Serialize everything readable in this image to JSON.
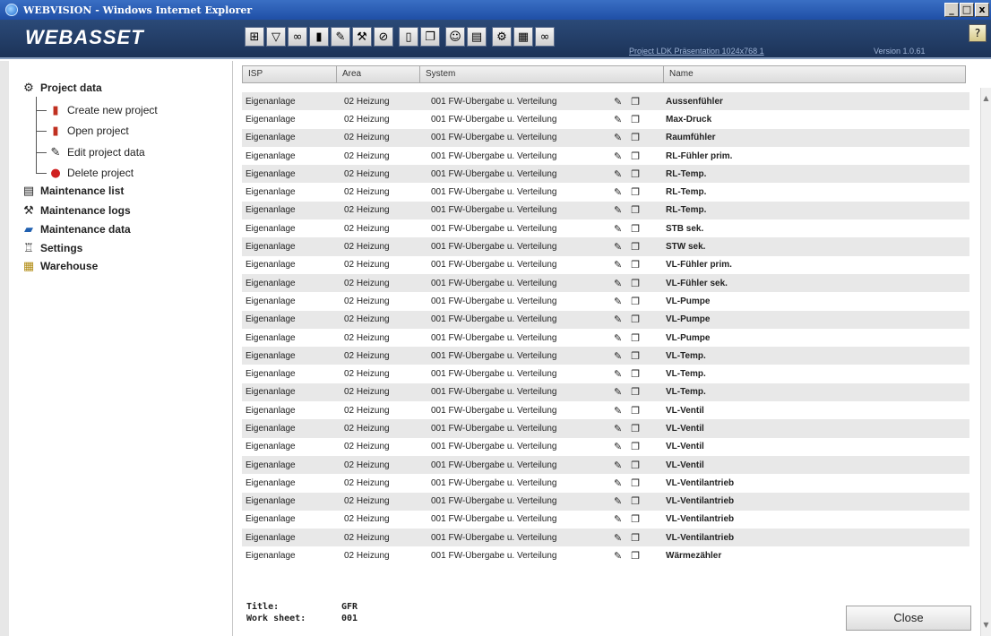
{
  "window": {
    "title": "WEBVISION - Windows Internet Explorer",
    "controls": [
      "_",
      "□",
      "x"
    ]
  },
  "app": {
    "brand": "WEBASSET",
    "project_link": "Project LDK Präsentation 1024x768 1",
    "version": "Version 1.0.61",
    "toolbar_icons": [
      "tree-icon",
      "filter-icon",
      "binoculars-icon",
      "book-icon",
      "edit-icon",
      "wrench-icon",
      "stop-icon",
      "new-document-icon",
      "copy-document-icon",
      "people-icon",
      "chart-icon",
      "maintenance-icon",
      "database-icon",
      "glasses-icon"
    ]
  },
  "sidebar": {
    "project_data": "Project data",
    "create_new_project": "Create new project",
    "open_project": "Open project",
    "edit_project_data": "Edit project data",
    "delete_project": "Delete project",
    "maintenance_list": "Maintenance list",
    "maintenance_logs": "Maintenance logs",
    "maintenance_data": "Maintenance data",
    "settings": "Settings",
    "warehouse": "Warehouse"
  },
  "table": {
    "headers": {
      "isp": "ISP",
      "area": "Area",
      "system": "System",
      "name": "Name"
    },
    "rows": [
      {
        "isp": "Eigenanlage",
        "area": "02 Heizung",
        "system": "001 FW-Übergabe u. Verteilung",
        "name": "Aussenfühler"
      },
      {
        "isp": "Eigenanlage",
        "area": "02 Heizung",
        "system": "001 FW-Übergabe u. Verteilung",
        "name": "Max-Druck"
      },
      {
        "isp": "Eigenanlage",
        "area": "02 Heizung",
        "system": "001 FW-Übergabe u. Verteilung",
        "name": "Raumfühler"
      },
      {
        "isp": "Eigenanlage",
        "area": "02 Heizung",
        "system": "001 FW-Übergabe u. Verteilung",
        "name": "RL-Fühler prim."
      },
      {
        "isp": "Eigenanlage",
        "area": "02 Heizung",
        "system": "001 FW-Übergabe u. Verteilung",
        "name": "RL-Temp."
      },
      {
        "isp": "Eigenanlage",
        "area": "02 Heizung",
        "system": "001 FW-Übergabe u. Verteilung",
        "name": "RL-Temp."
      },
      {
        "isp": "Eigenanlage",
        "area": "02 Heizung",
        "system": "001 FW-Übergabe u. Verteilung",
        "name": "RL-Temp."
      },
      {
        "isp": "Eigenanlage",
        "area": "02 Heizung",
        "system": "001 FW-Übergabe u. Verteilung",
        "name": "STB sek."
      },
      {
        "isp": "Eigenanlage",
        "area": "02 Heizung",
        "system": "001 FW-Übergabe u. Verteilung",
        "name": "STW sek."
      },
      {
        "isp": "Eigenanlage",
        "area": "02 Heizung",
        "system": "001 FW-Übergabe u. Verteilung",
        "name": "VL-Fühler prim."
      },
      {
        "isp": "Eigenanlage",
        "area": "02 Heizung",
        "system": "001 FW-Übergabe u. Verteilung",
        "name": "VL-Fühler sek."
      },
      {
        "isp": "Eigenanlage",
        "area": "02 Heizung",
        "system": "001 FW-Übergabe u. Verteilung",
        "name": "VL-Pumpe"
      },
      {
        "isp": "Eigenanlage",
        "area": "02 Heizung",
        "system": "001 FW-Übergabe u. Verteilung",
        "name": "VL-Pumpe"
      },
      {
        "isp": "Eigenanlage",
        "area": "02 Heizung",
        "system": "001 FW-Übergabe u. Verteilung",
        "name": "VL-Pumpe"
      },
      {
        "isp": "Eigenanlage",
        "area": "02 Heizung",
        "system": "001 FW-Übergabe u. Verteilung",
        "name": "VL-Temp."
      },
      {
        "isp": "Eigenanlage",
        "area": "02 Heizung",
        "system": "001 FW-Übergabe u. Verteilung",
        "name": "VL-Temp."
      },
      {
        "isp": "Eigenanlage",
        "area": "02 Heizung",
        "system": "001 FW-Übergabe u. Verteilung",
        "name": "VL-Temp."
      },
      {
        "isp": "Eigenanlage",
        "area": "02 Heizung",
        "system": "001 FW-Übergabe u. Verteilung",
        "name": "VL-Ventil"
      },
      {
        "isp": "Eigenanlage",
        "area": "02 Heizung",
        "system": "001 FW-Übergabe u. Verteilung",
        "name": "VL-Ventil"
      },
      {
        "isp": "Eigenanlage",
        "area": "02 Heizung",
        "system": "001 FW-Übergabe u. Verteilung",
        "name": "VL-Ventil"
      },
      {
        "isp": "Eigenanlage",
        "area": "02 Heizung",
        "system": "001 FW-Übergabe u. Verteilung",
        "name": "VL-Ventil"
      },
      {
        "isp": "Eigenanlage",
        "area": "02 Heizung",
        "system": "001 FW-Übergabe u. Verteilung",
        "name": "VL-Ventilantrieb"
      },
      {
        "isp": "Eigenanlage",
        "area": "02 Heizung",
        "system": "001 FW-Übergabe u. Verteilung",
        "name": "VL-Ventilantrieb"
      },
      {
        "isp": "Eigenanlage",
        "area": "02 Heizung",
        "system": "001 FW-Übergabe u. Verteilung",
        "name": "VL-Ventilantrieb"
      },
      {
        "isp": "Eigenanlage",
        "area": "02 Heizung",
        "system": "001 FW-Übergabe u. Verteilung",
        "name": "VL-Ventilantrieb"
      },
      {
        "isp": "Eigenanlage",
        "area": "02 Heizung",
        "system": "001 FW-Übergabe u. Verteilung",
        "name": "Wärmezähler"
      }
    ]
  },
  "footer": {
    "title_label": "Title:",
    "title_value": "GFR",
    "worksheet_label": "Work sheet:",
    "worksheet_value": "001",
    "close_label": "Close"
  }
}
